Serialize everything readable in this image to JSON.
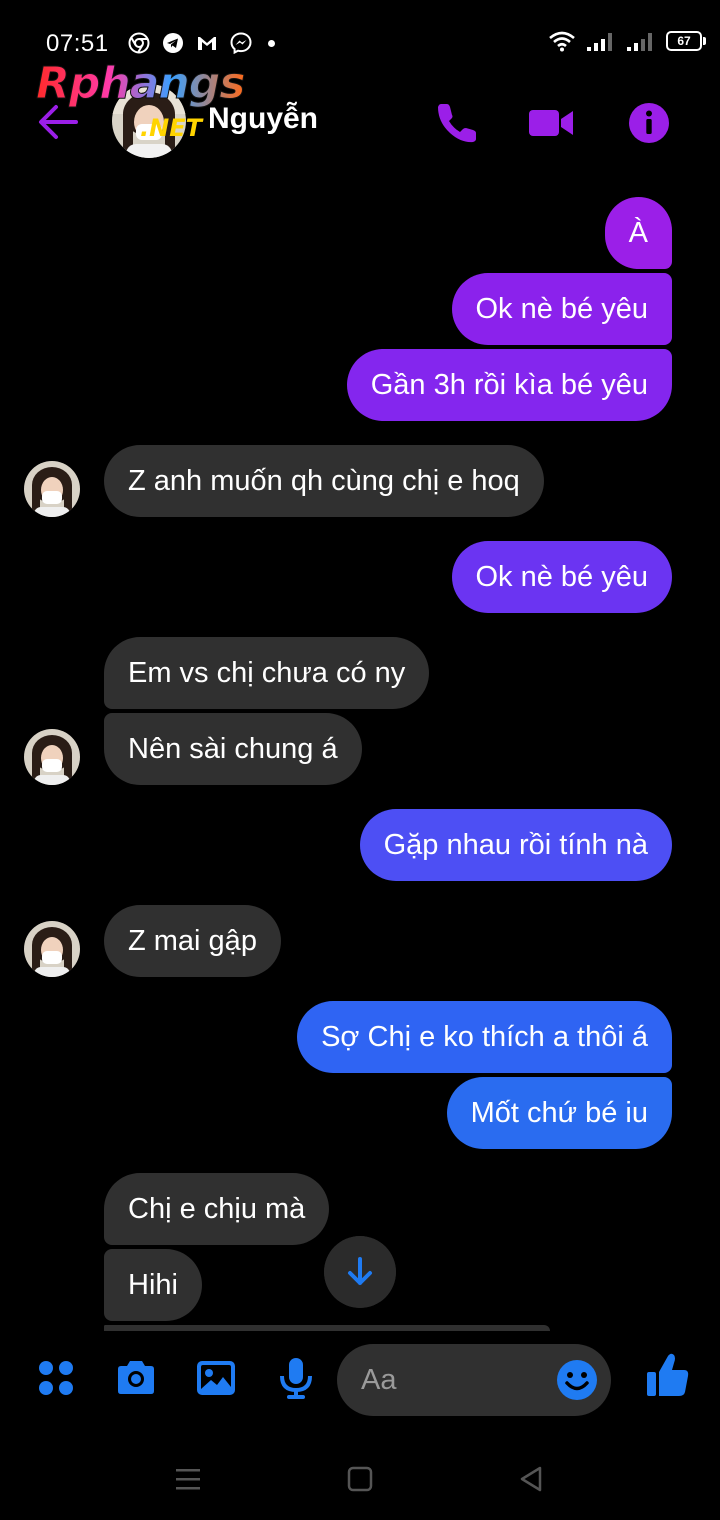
{
  "status_bar": {
    "time": "07:51",
    "battery": "67",
    "icons": [
      "chrome-icon",
      "telegram-icon",
      "gmail-icon",
      "messenger-icon",
      "notification-dot",
      "wifi-icon",
      "signal-icon",
      "signal-icon-2",
      "battery-icon"
    ]
  },
  "header": {
    "contact_name": "Nguyễn",
    "watermark_main": "Rphangs",
    "watermark_sub": ".NET",
    "icons": [
      "back-arrow-icon",
      "phone-icon",
      "video-camera-icon",
      "info-icon"
    ]
  },
  "messages": [
    {
      "from": "me",
      "text": "À",
      "color": "#9b1fe8"
    },
    {
      "from": "me",
      "text": "Ok nè bé yêu",
      "color": "#8b22ec"
    },
    {
      "from": "me",
      "text": "Gần 3h rồi kìa bé yêu",
      "color": "#8426ee"
    },
    {
      "from": "them",
      "text": "Z anh muốn qh cùng chị e hoq"
    },
    {
      "from": "me",
      "text": "Ok nè bé yêu",
      "color": "#6b34f2"
    },
    {
      "from": "them",
      "text": "Em vs chị chưa có ny"
    },
    {
      "from": "them",
      "text": "Nên sài chung á"
    },
    {
      "from": "me",
      "text": "Gặp nhau rồi tính nà",
      "color": "#4d4ff4"
    },
    {
      "from": "them",
      "text": "Z mai gập"
    },
    {
      "from": "me",
      "text": "Sợ Chị e ko thích a thôi á",
      "color": "#2f64f3"
    },
    {
      "from": "me",
      "text": "Mốt chứ bé iu",
      "color": "#2a6cf0"
    },
    {
      "from": "them",
      "text": "Chị e chịu mà"
    },
    {
      "from": "them",
      "text": "Hihi"
    }
  ],
  "composer": {
    "placeholder": "Aa",
    "icons": [
      "apps-icon",
      "camera-icon",
      "gallery-icon",
      "microphone-icon",
      "emoji-icon",
      "thumbs-up-icon"
    ]
  },
  "nav_bar": {
    "icons": [
      "recents-icon",
      "home-icon",
      "back-icon"
    ]
  },
  "colors": {
    "accent_blue": "#1f7bf2",
    "accent_purple": "#9b1fe8",
    "incoming_bubble": "#303030",
    "background": "#000000"
  }
}
